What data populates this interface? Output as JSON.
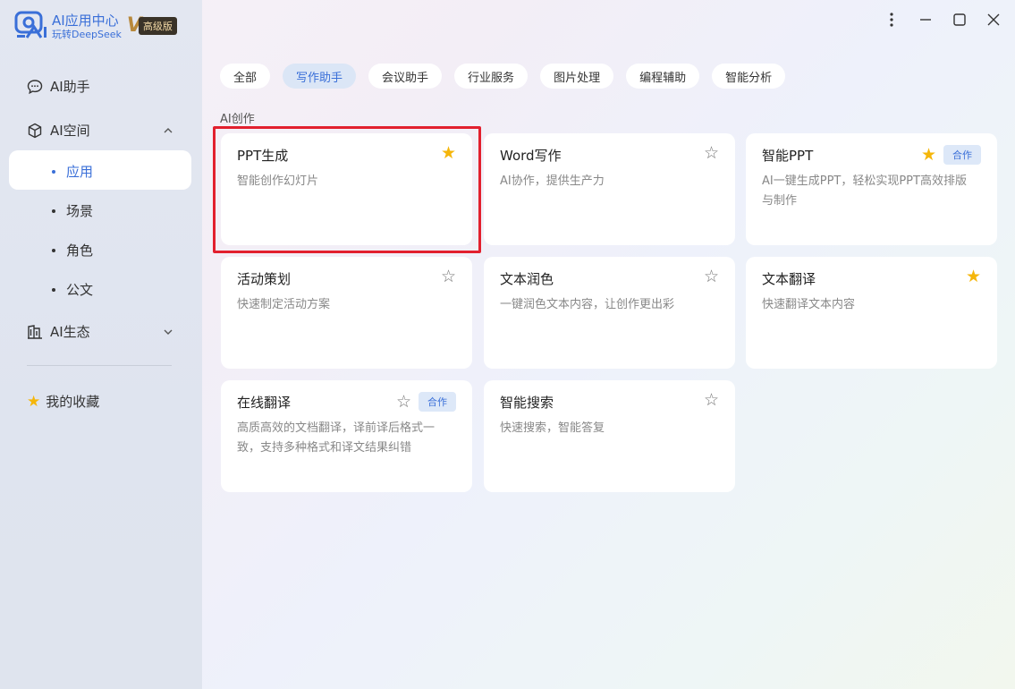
{
  "app": {
    "title": "AI应用中心",
    "subtitle": "玩转DeepSeek",
    "vip_mark": "V",
    "vip_label": "高级版",
    "brand_color": "#3a6fd8"
  },
  "sidebar": {
    "assistant": "AI助手",
    "space": "AI空间",
    "space_items": [
      "应用",
      "场景",
      "角色",
      "公文"
    ],
    "ecosystem": "AI生态",
    "favorites": "我的收藏"
  },
  "tabs": [
    "全部",
    "写作助手",
    "会议助手",
    "行业服务",
    "图片处理",
    "编程辅助",
    "智能分析"
  ],
  "active_tab": "写作助手",
  "section": "AI创作",
  "cards": [
    {
      "title": "PPT生成",
      "desc": "智能创作幻灯片",
      "favorited": true,
      "coop": ""
    },
    {
      "title": "Word写作",
      "desc": "AI协作，提供生产力",
      "favorited": false,
      "coop": ""
    },
    {
      "title": "智能PPT",
      "desc": "AI一键生成PPT，轻松实现PPT高效排版与制作",
      "favorited": true,
      "coop": "合作"
    },
    {
      "title": "活动策划",
      "desc": "快速制定活动方案",
      "favorited": false,
      "coop": ""
    },
    {
      "title": "文本润色",
      "desc": "一键润色文本内容，让创作更出彩",
      "favorited": false,
      "coop": ""
    },
    {
      "title": "文本翻译",
      "desc": "快速翻译文本内容",
      "favorited": true,
      "coop": ""
    },
    {
      "title": "在线翻译",
      "desc": "高质高效的文档翻译，译前译后格式一致，支持多种格式和译文结果纠错",
      "favorited": false,
      "coop": "合作"
    },
    {
      "title": "智能搜索",
      "desc": "快速搜索，智能答复",
      "favorited": false,
      "coop": ""
    }
  ],
  "icons": {
    "star_filled": "★",
    "star_empty": "☆",
    "window_menu": "more-vertical-icon",
    "window_min": "minimize-icon",
    "window_max": "maximize-icon",
    "window_close": "close-icon"
  },
  "colors": {
    "favorite": "#f5b60a",
    "highlight": "#e2202e",
    "active_tab_bg": "#dbe6f6"
  }
}
